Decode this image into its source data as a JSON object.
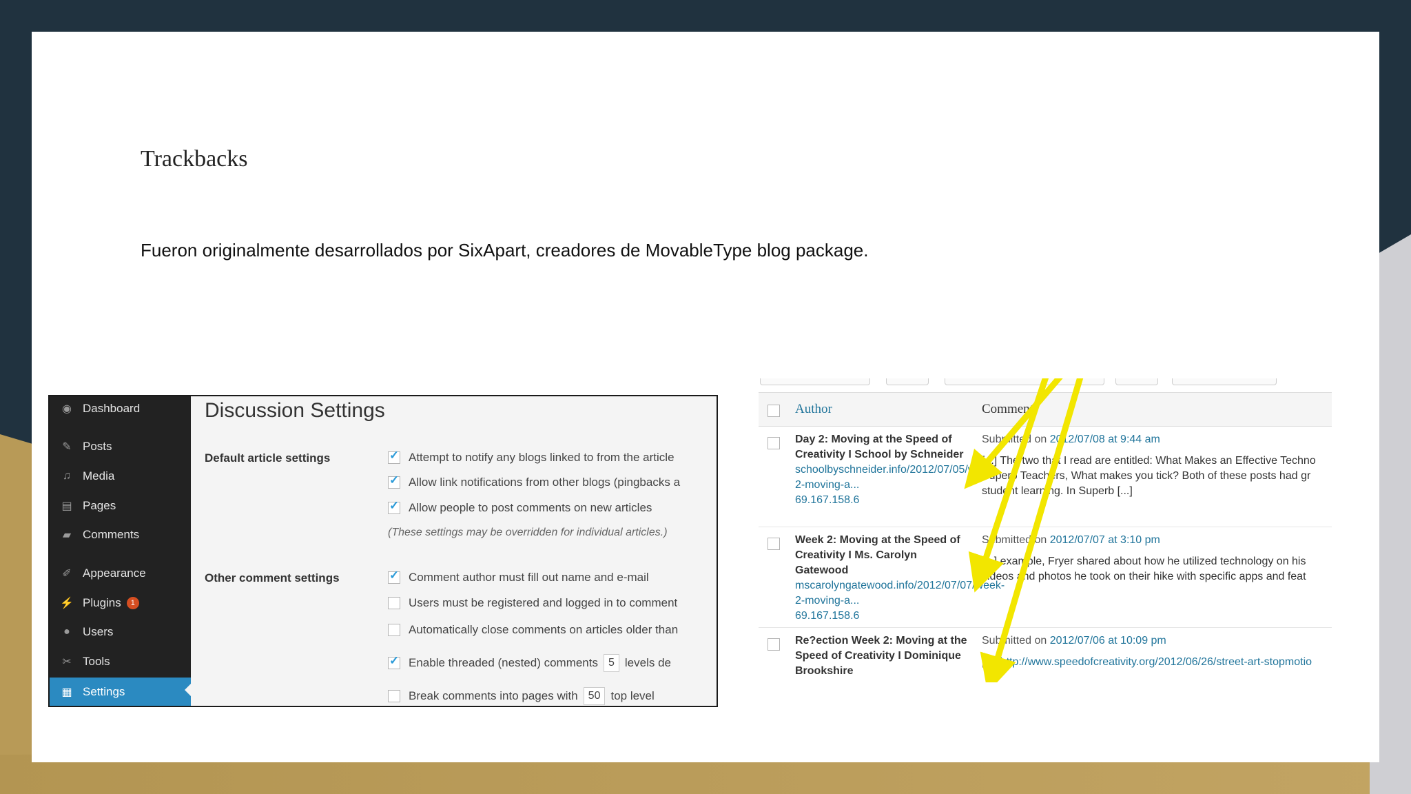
{
  "slide": {
    "title": "Trackbacks",
    "subtitle": "Fueron originalmente desarrollados por SixApart, creadores de MovableType blog package."
  },
  "wordpress": {
    "sidebar": [
      {
        "label": "Dashboard",
        "icon": "dashboard-icon"
      },
      {
        "label": "Posts",
        "icon": "pin-icon"
      },
      {
        "label": "Media",
        "icon": "media-icon"
      },
      {
        "label": "Pages",
        "icon": "pages-icon"
      },
      {
        "label": "Comments",
        "icon": "comment-icon"
      },
      {
        "label": "Appearance",
        "icon": "brush-icon"
      },
      {
        "label": "Plugins",
        "icon": "plug-icon",
        "badge": "1"
      },
      {
        "label": "Users",
        "icon": "user-icon"
      },
      {
        "label": "Tools",
        "icon": "wrench-icon"
      },
      {
        "label": "Settings",
        "icon": "settings-icon",
        "active": true
      }
    ],
    "heading": "Discussion Settings",
    "default_section": "Default article settings",
    "default_options": [
      {
        "label": "Attempt to notify any blogs linked to from the article",
        "checked": true
      },
      {
        "label": "Allow link notifications from other blogs (pingbacks a",
        "checked": true
      },
      {
        "label": "Allow people to post comments on new articles",
        "checked": true
      }
    ],
    "default_note": "(These settings may be overridden for individual articles.)",
    "other_section": "Other comment settings",
    "other_options": [
      {
        "label": "Comment author must fill out name and e-mail",
        "checked": true
      },
      {
        "label": "Users must be registered and logged in to comment",
        "checked": false
      },
      {
        "label": "Automatically close comments on articles older than",
        "checked": false
      }
    ],
    "threaded": {
      "label": "Enable threaded (nested) comments",
      "value": "5",
      "suffix": "levels de",
      "checked": true
    },
    "paging": {
      "label": "Break comments into pages with",
      "value": "50",
      "suffix": "top level",
      "checked": false
    },
    "colors": {
      "sidebar": "#222222",
      "active": "#2b8ac1",
      "badge": "#d54e21"
    }
  },
  "comments": {
    "header_author": "Author",
    "header_comment": "Comment",
    "rows": [
      {
        "author": "Day 2: Moving at the Speed of Creativity I School by Schneider",
        "url": "schoolbyschneider.info/2012/07/05/week-2-moving-a...",
        "ip": "69.167.158.6",
        "submitted_prefix": "Submitted on",
        "date": "2012/07/08 at 9:44 am",
        "text1": "[...] The two that I read are entitled: What Makes an Effective Techno",
        "text2": "Superb Teachers, What makes you tick? Both of these posts had gr",
        "text3": "student learning. In Superb [...]"
      },
      {
        "author": "Week 2: Moving at the Speed of Creativity I Ms. Carolyn Gatewood",
        "url": "mscarolyngatewood.info/2012/07/07/week-2-moving-a...",
        "ip": "69.167.158.6",
        "submitted_prefix": "Submitted on",
        "date": "2012/07/07 at 3:10 pm",
        "text1": "[...] example, Fryer shared about how he utilized technology on his",
        "text2": "videos and photos he took on their hike with specific apps and feat",
        "text3": ""
      },
      {
        "author": "Re?ection Week 2: Moving at the Speed of Creativity I Dominique Brookshire",
        "url": "",
        "ip": "",
        "submitted_prefix": "Submitted on",
        "date": "2012/07/06 at 10:09 pm",
        "text1": "[...] ",
        "link": "http://www.speedofcreativity.org/2012/06/26/street-art-stopmotio",
        "text2": "",
        "text3": ""
      }
    ],
    "colors": {
      "link": "#21759b",
      "arrow": "#f2e600"
    }
  }
}
